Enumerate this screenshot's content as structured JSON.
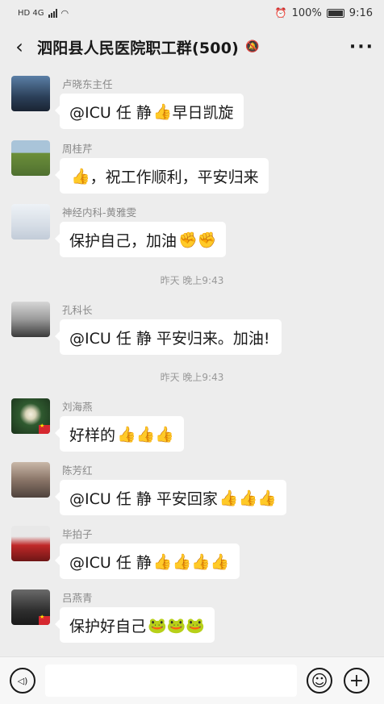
{
  "status_bar": {
    "network_label": "HD 4G",
    "battery_percent": "100%",
    "time": "9:16"
  },
  "header": {
    "back_glyph": "‹",
    "title": "泗阳县人民医院职工群(500)",
    "muted_icon": "bell-off-icon",
    "more_glyph": "···"
  },
  "messages": [
    {
      "sender": "卢晓东主任",
      "text": "@ICU 任  静 ",
      "emojis": "👍",
      "suffix": "早日凯旋",
      "avatar_color": "#3d5a7a"
    },
    {
      "sender": "周桂芹",
      "text": "",
      "emojis": "👍",
      "suffix": "，祝工作顺利，平安归来",
      "avatar_color": "#7a9a4a"
    },
    {
      "sender": "神经内科-黄雅雯",
      "text": "保护自己，加油",
      "emojis": "✊✊",
      "suffix": "",
      "avatar_color": "#d8e0ea"
    },
    {
      "sender": "孔科长",
      "text": "@ICU 任  静  平安归来。加油!",
      "emojis": "",
      "suffix": "",
      "avatar_color": "#8c8c8c"
    },
    {
      "sender": "刘海燕",
      "text": "好样的",
      "emojis": "👍👍👍",
      "suffix": "",
      "avatar_color": "#2e4a2e"
    },
    {
      "sender": "陈芳红",
      "text": "@ICU 任  静  平安回家",
      "emojis": "👍👍👍",
      "suffix": "",
      "avatar_color": "#8a7a70"
    },
    {
      "sender": "毕拍子",
      "text": "@ICU 任  静 ",
      "emojis": "👍👍👍👍",
      "suffix": "",
      "avatar_color": "#a33030"
    },
    {
      "sender": "吕燕青",
      "text": "保护好自己",
      "emojis": "🐸🐸🐸",
      "suffix": "",
      "avatar_color": "#3a3a3a"
    }
  ],
  "timestamps": [
    "昨天 晚上9:43",
    "昨天 晚上9:43"
  ],
  "input_bar": {
    "voice_glyph": "◁)",
    "emoji_glyph": "☺",
    "plus_glyph": "+"
  }
}
